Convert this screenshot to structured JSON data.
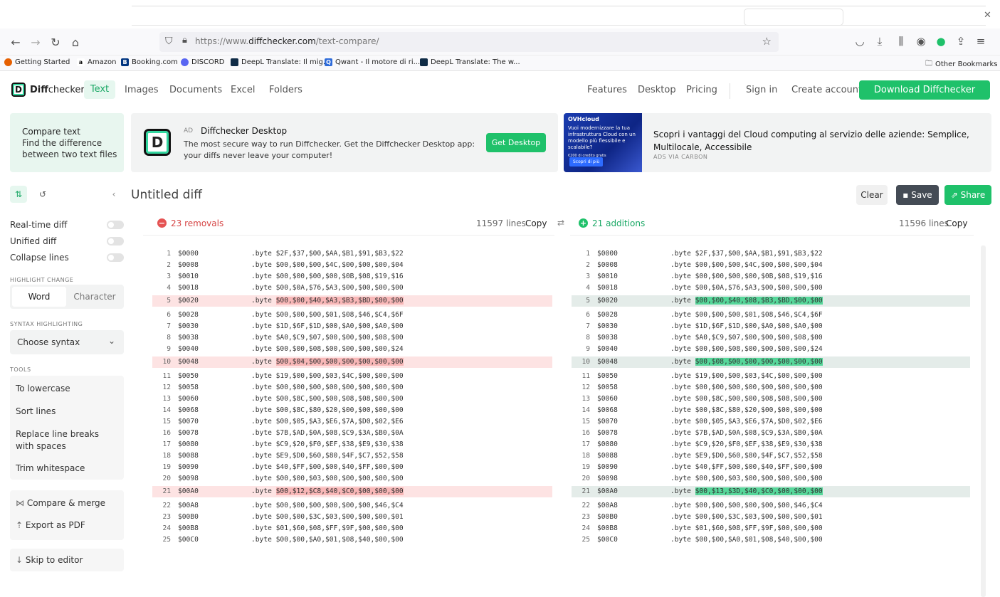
{
  "browser": {
    "url_prefix": "https://www.",
    "url_domain": "diffchecker.com",
    "url_path": "/text-compare/",
    "bookmarks": [
      {
        "label": "Getting Started",
        "icon": "firefox-icon",
        "color": "#e66000"
      },
      {
        "label": "Amazon",
        "icon": "amazon-icon",
        "color": "#ff9900"
      },
      {
        "label": "Booking.com",
        "icon": "booking-icon",
        "color": "#003580"
      },
      {
        "label": "DISCORD",
        "icon": "discord-icon",
        "color": "#5865f2"
      },
      {
        "label": "DeepL Translate: Il mig...",
        "icon": "deepl-icon",
        "color": "#0f2b46"
      },
      {
        "label": "Qwant - Il motore di ri...",
        "icon": "qwant-icon",
        "color": "#2e6bd9"
      },
      {
        "label": "DeepL Translate: The w...",
        "icon": "deepl-icon",
        "color": "#0f2b46"
      }
    ],
    "other_bookmarks": "Other Bookmarks"
  },
  "header": {
    "brand_diff": "Diff",
    "brand_checker": "checker",
    "nav_left": [
      "Text",
      "Images",
      "Documents",
      "Excel",
      "Folders"
    ],
    "nav_right": [
      "Features",
      "Desktop",
      "Pricing"
    ],
    "sign_in": "Sign in",
    "create_account": "Create account",
    "download": "Download Diffchecker Desktop",
    "accent": "#1fc16a"
  },
  "compare_box": {
    "title": "Compare text",
    "line1": "Find the difference",
    "line2": "between two text files"
  },
  "ad": {
    "tag": "AD",
    "title": "Diffchecker Desktop",
    "text": "The most secure way to run Diffchecker. Get the Diffchecker Desktop app: your diffs never leave your computer!",
    "button": "Get Desktop"
  },
  "carbon": {
    "brand": "OVHcloud",
    "img_text": "Vuoi modernizzare la tua infrastruttura Cloud con un modello più flessibile e scalabile?",
    "img_small": "€200 di credito gratis",
    "img_button": "Scopri di più",
    "text": "Scopri i vantaggi del Cloud computing al servizio delle aziende: Semplice, Multilocale, Accessibile",
    "via": "ADS VIA CARBON"
  },
  "sidebar": {
    "toggles": [
      "Real-time diff",
      "Unified diff",
      "Collapse lines"
    ],
    "highlight_change": "HIGHLIGHT CHANGE",
    "word": "Word",
    "character": "Character",
    "syntax_highlighting": "SYNTAX HIGHLIGHTING",
    "choose_syntax": "Choose syntax",
    "tools_heading": "TOOLS",
    "tools": [
      "To lowercase",
      "Sort lines",
      "Replace line breaks with spaces",
      "Trim whitespace"
    ],
    "compare_merge": "Compare & merge",
    "export_pdf": "Export as PDF",
    "skip": "Skip to editor"
  },
  "main": {
    "title": "Untitled diff",
    "clear": "Clear",
    "save": "Save",
    "share": "Share",
    "left_summary": "23 removals",
    "left_lines": "11597 lines",
    "right_summary": "21 additions",
    "right_lines": "11596 lines",
    "copy": "Copy",
    "removal_color": "#e55353",
    "addition_color": "#1fc16a"
  },
  "diff": {
    "left": [
      {
        "n": "1",
        "a": "$0000",
        "d": ".byte $2F,$37,$00,$AA,$B1,$91,$B3,$22"
      },
      {
        "n": "2",
        "a": "$0008",
        "d": ".byte $00,$00,$00,$4C,$00,$00,$00,$04"
      },
      {
        "n": "3",
        "a": "$0010",
        "d": ".byte $00,$00,$00,$00,$0B,$08,$19,$16"
      },
      {
        "n": "4",
        "a": "$0018",
        "d": ".byte $00,$0A,$76,$A3,$00,$00,$00,$00"
      },
      {
        "n": "5",
        "a": "$0020",
        "d": ".byte ",
        "h": "$00,$00,$40,$A3,$B3,$BD,$00,$00",
        "t": "del"
      },
      {
        "n": "6",
        "a": "$0028",
        "d": ".byte $00,$00,$00,$01,$08,$46,$C4,$6F"
      },
      {
        "n": "7",
        "a": "$0030",
        "d": ".byte $1D,$6F,$1D,$00,$A0,$00,$A0,$00"
      },
      {
        "n": "8",
        "a": "$0038",
        "d": ".byte $A0,$C9,$07,$00,$00,$00,$08,$00"
      },
      {
        "n": "9",
        "a": "$0040",
        "d": ".byte $00,$00,$08,$00,$00,$00,$00,$24"
      },
      {
        "n": "10",
        "a": "$0048",
        "d": ".byte ",
        "h": "$00,$04,$00,$00,$00,$00,$00,$00",
        "t": "del"
      },
      {
        "n": "11",
        "a": "$0050",
        "d": ".byte $19,$00,$00,$03,$4C,$00,$00,$00"
      },
      {
        "n": "12",
        "a": "$0058",
        "d": ".byte $00,$00,$00,$00,$00,$00,$00,$00"
      },
      {
        "n": "13",
        "a": "$0060",
        "d": ".byte $00,$8C,$00,$00,$08,$08,$00,$00"
      },
      {
        "n": "14",
        "a": "$0068",
        "d": ".byte $00,$8C,$80,$20,$00,$00,$00,$00"
      },
      {
        "n": "15",
        "a": "$0070",
        "d": ".byte $00,$05,$A3,$E6,$7A,$D0,$02,$E6"
      },
      {
        "n": "16",
        "a": "$0078",
        "d": ".byte $7B,$AD,$0A,$08,$C9,$3A,$B0,$0A"
      },
      {
        "n": "17",
        "a": "$0080",
        "d": ".byte $C9,$20,$F0,$EF,$38,$E9,$30,$38"
      },
      {
        "n": "18",
        "a": "$0088",
        "d": ".byte $E9,$D0,$60,$80,$4F,$C7,$52,$58"
      },
      {
        "n": "19",
        "a": "$0090",
        "d": ".byte $40,$FF,$00,$00,$40,$FF,$00,$00"
      },
      {
        "n": "20",
        "a": "$0098",
        "d": ".byte $00,$00,$03,$00,$00,$00,$00,$00"
      },
      {
        "n": "21",
        "a": "$00A0",
        "d": ".byte ",
        "h": "$00,$12,$C8,$40,$C0,$00,$00,$00",
        "t": "del"
      },
      {
        "n": "22",
        "a": "$00A8",
        "d": ".byte $00,$00,$00,$00,$00,$00,$46,$C4"
      },
      {
        "n": "23",
        "a": "$00B0",
        "d": ".byte $00,$00,$3C,$03,$00,$00,$00,$01"
      },
      {
        "n": "24",
        "a": "$00B8",
        "d": ".byte $01,$60,$08,$FF,$9F,$00,$00,$00"
      },
      {
        "n": "25",
        "a": "$00C0",
        "d": ".byte $00,$00,$A0,$01,$08,$40,$00,$00"
      }
    ],
    "right": [
      {
        "n": "1",
        "a": "$0000",
        "d": ".byte $2F,$37,$00,$AA,$B1,$91,$B3,$22"
      },
      {
        "n": "2",
        "a": "$0008",
        "d": ".byte $00,$00,$00,$4C,$00,$00,$00,$04"
      },
      {
        "n": "3",
        "a": "$0010",
        "d": ".byte $00,$00,$00,$00,$0B,$08,$19,$16"
      },
      {
        "n": "4",
        "a": "$0018",
        "d": ".byte $00,$0A,$76,$A3,$00,$00,$00,$00"
      },
      {
        "n": "5",
        "a": "$0020",
        "d": ".byte ",
        "h": "$00,$00,$40,$08,$B3,$BD,$00,$00",
        "t": "ins"
      },
      {
        "n": "6",
        "a": "$0028",
        "d": ".byte $00,$00,$00,$01,$08,$46,$C4,$6F"
      },
      {
        "n": "7",
        "a": "$0030",
        "d": ".byte $1D,$6F,$1D,$00,$A0,$00,$A0,$00"
      },
      {
        "n": "8",
        "a": "$0038",
        "d": ".byte $A0,$C9,$07,$00,$00,$00,$08,$00"
      },
      {
        "n": "9",
        "a": "$0040",
        "d": ".byte $00,$00,$08,$00,$00,$00,$00,$24"
      },
      {
        "n": "10",
        "a": "$0048",
        "d": ".byte ",
        "h": "$00,$08,$00,$00,$00,$00,$00,$00",
        "t": "ins"
      },
      {
        "n": "11",
        "a": "$0050",
        "d": ".byte $19,$00,$00,$03,$4C,$00,$00,$00"
      },
      {
        "n": "12",
        "a": "$0058",
        "d": ".byte $00,$00,$00,$00,$00,$00,$00,$00"
      },
      {
        "n": "13",
        "a": "$0060",
        "d": ".byte $00,$8C,$00,$00,$08,$08,$00,$00"
      },
      {
        "n": "14",
        "a": "$0068",
        "d": ".byte $00,$8C,$80,$20,$00,$00,$00,$00"
      },
      {
        "n": "15",
        "a": "$0070",
        "d": ".byte $00,$05,$A3,$E6,$7A,$D0,$02,$E6"
      },
      {
        "n": "16",
        "a": "$0078",
        "d": ".byte $7B,$AD,$0A,$08,$C9,$3A,$B0,$0A"
      },
      {
        "n": "17",
        "a": "$0080",
        "d": ".byte $C9,$20,$F0,$EF,$38,$E9,$30,$38"
      },
      {
        "n": "18",
        "a": "$0088",
        "d": ".byte $E9,$D0,$60,$80,$4F,$C7,$52,$58"
      },
      {
        "n": "19",
        "a": "$0090",
        "d": ".byte $40,$FF,$00,$00,$40,$FF,$00,$00"
      },
      {
        "n": "20",
        "a": "$0098",
        "d": ".byte $00,$00,$03,$00,$00,$00,$00,$00"
      },
      {
        "n": "21",
        "a": "$00A0",
        "d": ".byte ",
        "h": "$00,$13,$3D,$40,$C0,$00,$00,$00",
        "t": "ins"
      },
      {
        "n": "22",
        "a": "$00A8",
        "d": ".byte $00,$00,$00,$00,$00,$00,$46,$C4"
      },
      {
        "n": "23",
        "a": "$00B0",
        "d": ".byte $00,$00,$3C,$03,$00,$00,$00,$01"
      },
      {
        "n": "24",
        "a": "$00B8",
        "d": ".byte $01,$60,$08,$FF,$9F,$00,$00,$00"
      },
      {
        "n": "25",
        "a": "$00C0",
        "d": ".byte $00,$00,$A0,$01,$08,$40,$00,$00"
      }
    ]
  }
}
